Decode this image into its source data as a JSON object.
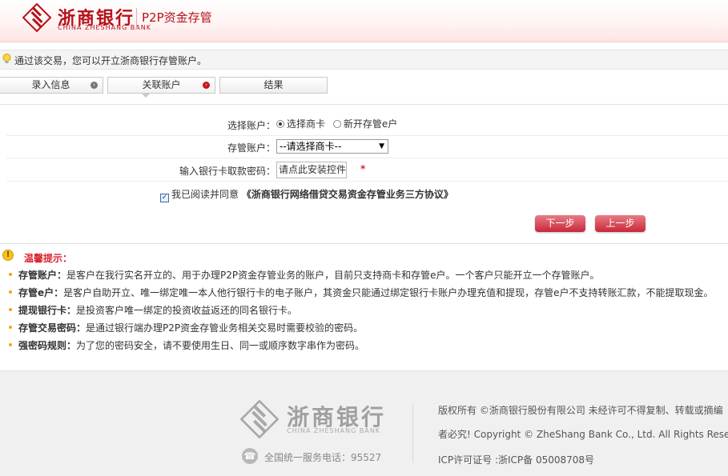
{
  "header": {
    "bank_name": "浙商银行",
    "bank_name_en": "CHINA ZHESHANG BANK",
    "product": "P2P资金存管"
  },
  "notice": {
    "text": "通过该交易，您可以开立浙商银行存管账户。"
  },
  "steps": [
    {
      "label": "录入信息"
    },
    {
      "label": "关联账户"
    },
    {
      "label": "结果"
    }
  ],
  "form": {
    "account_type_label": "选择账户：",
    "option_merchant_card": "选择商卡",
    "option_new_account": "新开存管e户",
    "custody_account_label": "存管账户：",
    "custody_account_value": "--请选择商卡--",
    "password_label": "输入银行卡取款密码：",
    "password_placeholder": "请点此安装控件",
    "required_mark": "*",
    "agree_prefix": "我已阅读并同意",
    "agree_link": "《浙商银行网络借贷交易资金存管业务三方协议》"
  },
  "buttons": {
    "next": "下一步",
    "prev": "上一步"
  },
  "tips": {
    "title": "温馨提示：",
    "items": [
      {
        "term": "存管账户：",
        "text": "是客户在我行实名开立的、用于办理P2P资金存管业务的账户，目前只支持商卡和存管e户。一个客户只能开立一个存管账户。"
      },
      {
        "term": "存管e户：",
        "text": "是客户自助开立、唯一绑定唯一本人他行银行卡的电子账户，其资金只能通过绑定银行卡账户办理充值和提现，存管e户不支持转账汇款，不能提取现金。"
      },
      {
        "term": "提现银行卡：",
        "text": "是投资客户唯一绑定的投资收益返还的同名银行卡。"
      },
      {
        "term": "存管交易密码：",
        "text": "是通过银行端办理P2P资金存管业务相关交易时需要校验的密码。"
      },
      {
        "term": "强密码规则：",
        "text": "为了您的密码安全，请不要使用生日、同一或顺序数字串作为密码。"
      }
    ]
  },
  "footer": {
    "bank_name": "浙商银行",
    "bank_name_en": "CHINA ZHESHANG BANK",
    "service_phone": "全国统一服务电话：95527",
    "copyright_1": "版权所有 ©浙商银行股份有限公司 未经许可不得复制、转载或摘编",
    "copyright_2": "者必究! Copyright © ZheShang Bank Co., Ltd. All Rights Reserved",
    "icp": "ICP许可证号 :浙ICP备 05008708号"
  },
  "colors": {
    "brand_red": "#b5121b",
    "button_red": "#c8283a",
    "tip_bullet": "#f2a900"
  }
}
